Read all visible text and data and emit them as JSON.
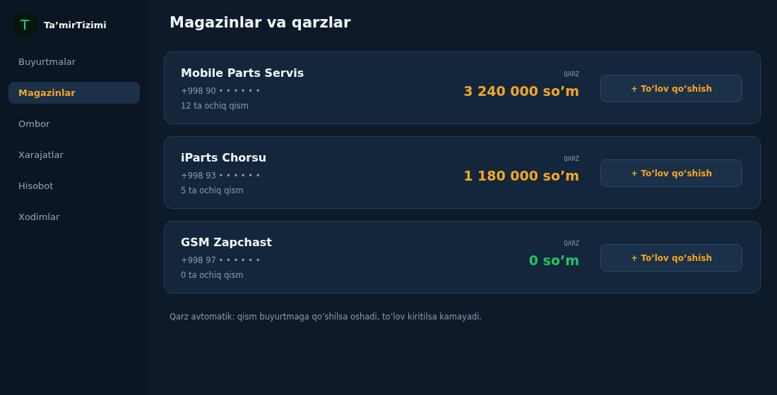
{
  "brand": {
    "logo": "T",
    "name": "Ta’mirTizimi"
  },
  "sidebar": {
    "items": [
      {
        "label": "Buyurtmalar",
        "selected": false
      },
      {
        "label": "Magazinlar",
        "selected": true
      },
      {
        "label": "Ombor",
        "selected": false
      },
      {
        "label": "Xarajatlar",
        "selected": false
      },
      {
        "label": "Hisobot",
        "selected": false
      },
      {
        "label": "Xodimlar",
        "selected": false
      }
    ]
  },
  "page": {
    "title": "Magazinlar va qarzlar"
  },
  "shops": [
    {
      "name": "Mobile Parts Servis",
      "phone": "+998 90 • • • • • •",
      "open_parts": "12 ta ochiq qism",
      "debt_label": "QARZ",
      "debt": "3 240 000 so’m",
      "color": "#f5a623",
      "button": "+ To’lov qo’shish"
    },
    {
      "name": "iParts Chorsu",
      "phone": "+998 93 • • • • • •",
      "open_parts": "5 ta ochiq qism",
      "debt_label": "QARZ",
      "debt": "1 180 000 so’m",
      "color": "#f5a623",
      "button": "+ To’lov qo’shish"
    },
    {
      "name": "GSM Zapchast",
      "phone": "+998 97 • • • • • •",
      "open_parts": "0 ta ochiq qism",
      "debt_label": "QARZ",
      "debt": "0 so’m",
      "color": "#22c55e",
      "button": "+ To’lov qo’shish"
    }
  ],
  "note": "Qarz avtomatik: qism buyurtmaga qo’shilsa oshadi, to’lov kiritilsa kamayadi."
}
